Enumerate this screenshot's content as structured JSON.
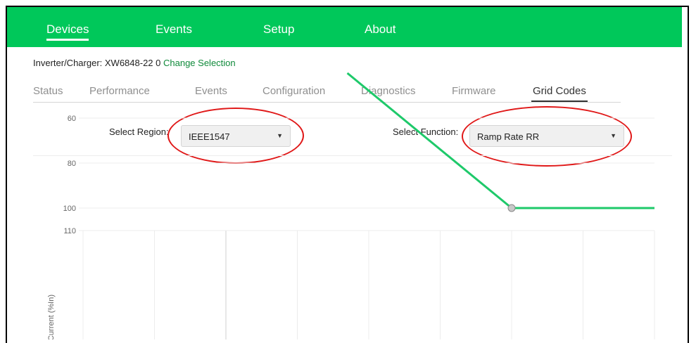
{
  "nav": {
    "items": [
      {
        "label": "Devices",
        "active": true
      },
      {
        "label": "Events",
        "active": false
      },
      {
        "label": "Setup",
        "active": false
      },
      {
        "label": "About",
        "active": false
      }
    ]
  },
  "device": {
    "prefix": "Inverter/Charger: XW6848-22 0",
    "change_label": "Change Selection"
  },
  "tabs": [
    {
      "label": "Status",
      "active": false
    },
    {
      "label": "Performance",
      "active": false
    },
    {
      "label": "Events",
      "active": false
    },
    {
      "label": "Configuration",
      "active": false
    },
    {
      "label": "Diagnostics",
      "active": false
    },
    {
      "label": "Firmware",
      "active": false
    },
    {
      "label": "Grid Codes",
      "active": true
    }
  ],
  "filters": {
    "region_label": "Select Region:",
    "region_value": "IEEE1547",
    "function_label": "Select Function:",
    "function_value": "Ramp Rate RR"
  },
  "colors": {
    "nav_bg": "#00c85a",
    "line": "#1ec96a",
    "highlight": "#e01818",
    "link": "#0f8a3a"
  },
  "chart_data": {
    "type": "line",
    "ylabel": "Current (%In)",
    "y_ticks": [
      60,
      80,
      100,
      110
    ],
    "ylim": [
      40,
      110
    ],
    "xlim": [
      0,
      8
    ],
    "grid": true,
    "series": [
      {
        "x": [
          3.7,
          6,
          8
        ],
        "y": [
          40,
          100,
          100
        ],
        "markers": [
          {
            "x": 6,
            "y": 100
          }
        ]
      }
    ]
  }
}
